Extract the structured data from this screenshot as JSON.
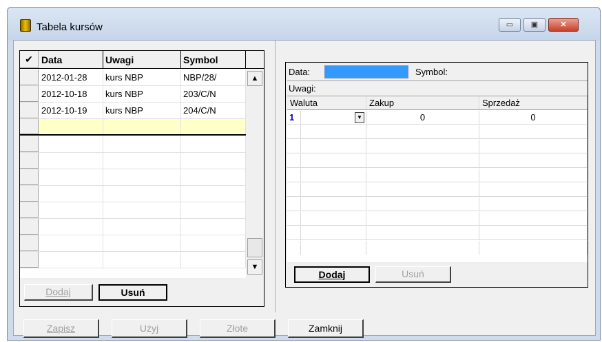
{
  "window": {
    "title": "Tabela kursów",
    "controls": {
      "minimize": "▭",
      "maximize": "▣",
      "close": "✕"
    }
  },
  "left_table": {
    "header_icon": "✔",
    "columns": [
      "Data",
      "Uwagi",
      "Symbol"
    ],
    "rows": [
      {
        "data": "2012-01-28",
        "uwagi": "kurs NBP",
        "symbol": "NBP/28/"
      },
      {
        "data": "2012-10-18",
        "uwagi": "kurs NBP",
        "symbol": "203/C/N"
      },
      {
        "data": "2012-10-19",
        "uwagi": "kurs NBP",
        "symbol": "204/C/N"
      }
    ],
    "buttons": {
      "add": "Dodaj",
      "delete": "Usuń"
    }
  },
  "detail": {
    "data_label": "Data:",
    "symbol_label": "Symbol:",
    "uwagi_label": "Uwagi:",
    "columns": [
      "Waluta",
      "Zakup",
      "Sprzedaż"
    ],
    "first_row": {
      "index": "1",
      "waluta": "",
      "zakup": "0",
      "sprzedaz": "0"
    },
    "buttons": {
      "add": "Dodaj",
      "delete": "Usuń"
    }
  },
  "footer_buttons": {
    "save": "Zapisz",
    "use": "Użyj",
    "zlote": "Złote",
    "close": "Zamknij"
  },
  "colors": {
    "accent_field": "#3399ff",
    "selected_row": "#ffffc8"
  }
}
